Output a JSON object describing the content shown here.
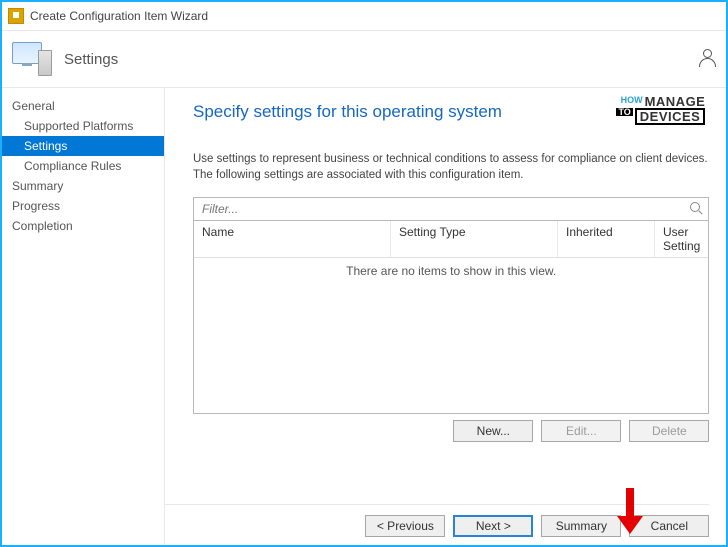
{
  "window": {
    "title": "Create Configuration Item Wizard"
  },
  "header": {
    "step_label": "Settings"
  },
  "sidebar": {
    "items": [
      {
        "label": "General"
      },
      {
        "label": "Supported Platforms"
      },
      {
        "label": "Settings"
      },
      {
        "label": "Compliance Rules"
      },
      {
        "label": "Summary"
      },
      {
        "label": "Progress"
      },
      {
        "label": "Completion"
      }
    ]
  },
  "content": {
    "heading": "Specify settings for this operating system",
    "description": "Use settings to represent business or technical conditions to assess for compliance on client devices. The following settings are associated with this configuration item.",
    "filter_placeholder": "Filter...",
    "columns": {
      "name": "Name",
      "type": "Setting Type",
      "inherited": "Inherited",
      "user_setting": "User Setting"
    },
    "empty_text": "There are no items to show in this view.",
    "row_buttons": {
      "new": "New...",
      "edit": "Edit...",
      "delete": "Delete"
    }
  },
  "footer": {
    "previous": "< Previous",
    "next": "Next >",
    "summary": "Summary",
    "cancel": "Cancel"
  },
  "watermark": {
    "how": "HOW",
    "to": "TO",
    "line1": "MANAGE",
    "line2": "DEVICES"
  }
}
